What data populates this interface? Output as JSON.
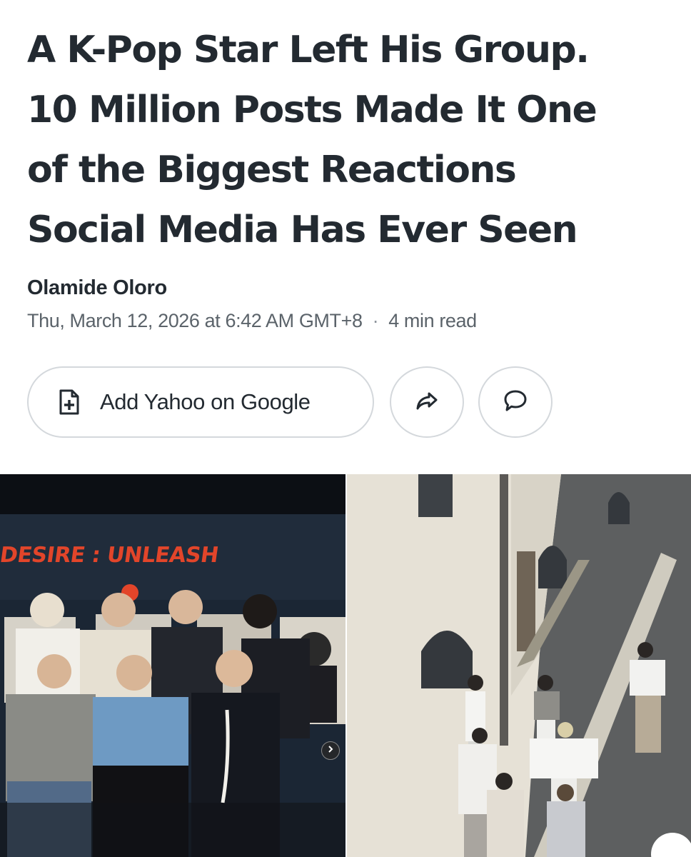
{
  "article": {
    "headline_lines": [
      "A K-Pop Star Left His Group.",
      "10 Million Posts Made It One",
      "of the Biggest Reactions",
      "Social Media Has Ever Seen"
    ],
    "author": "Olamide Oloro",
    "date": "Thu, March 12, 2026 at 6:42 AM GMT+8",
    "separator": "·",
    "read_time": "4 min read"
  },
  "actions": {
    "add_source_label": "Add Yahoo on Google",
    "add_source_icon": "add-document-icon",
    "share_icon": "share-arrow-icon",
    "comment_icon": "comment-bubble-icon"
  },
  "media": {
    "left_photo": {
      "banner_text": "DESIRE : UNLEASH",
      "carousel_icon": "chevron-right-icon"
    },
    "right_photo": {}
  },
  "colors": {
    "text": "#232a31",
    "meta_text": "#5b636a",
    "border": "#d4d8dc",
    "banner_red": "#e2452a"
  }
}
